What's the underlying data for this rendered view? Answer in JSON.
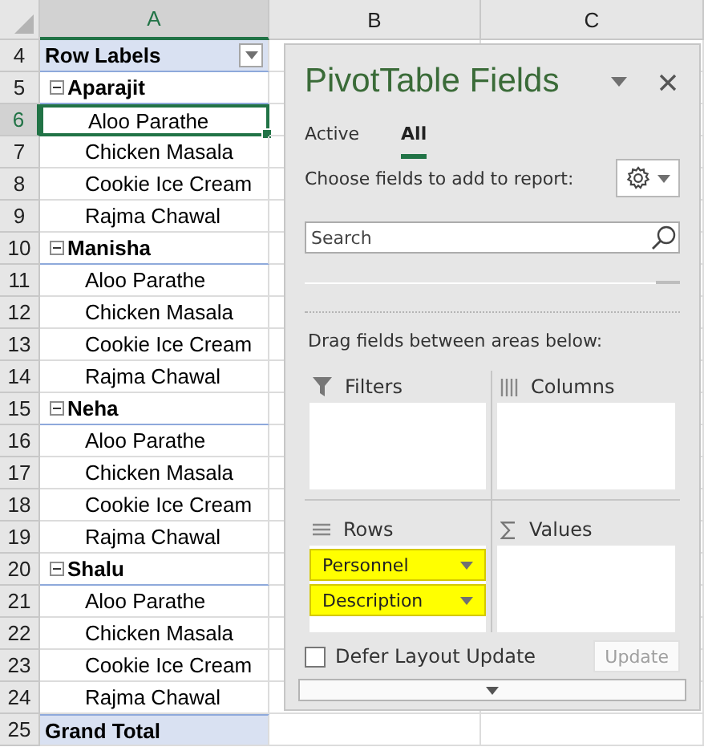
{
  "sheet": {
    "columns": [
      {
        "label": "A",
        "selected": true
      },
      {
        "label": "B",
        "selected": false
      },
      {
        "label": "C",
        "selected": false
      }
    ],
    "rows": [
      {
        "number": "4",
        "kind": "header",
        "label": "Row Labels",
        "selected": false
      },
      {
        "number": "5",
        "kind": "group",
        "label": "Aparajit",
        "expanded": true,
        "selected": false
      },
      {
        "number": "6",
        "kind": "item",
        "label": "Aloo Parathe",
        "selected": true
      },
      {
        "number": "7",
        "kind": "item",
        "label": "Chicken Masala",
        "selected": false
      },
      {
        "number": "8",
        "kind": "item",
        "label": "Cookie Ice Cream",
        "selected": false
      },
      {
        "number": "9",
        "kind": "item",
        "label": "Rajma Chawal",
        "selected": false
      },
      {
        "number": "10",
        "kind": "group",
        "label": "Manisha",
        "expanded": true,
        "selected": false
      },
      {
        "number": "11",
        "kind": "item",
        "label": "Aloo Parathe",
        "selected": false
      },
      {
        "number": "12",
        "kind": "item",
        "label": "Chicken Masala",
        "selected": false
      },
      {
        "number": "13",
        "kind": "item",
        "label": "Cookie Ice Cream",
        "selected": false
      },
      {
        "number": "14",
        "kind": "item",
        "label": "Rajma Chawal",
        "selected": false
      },
      {
        "number": "15",
        "kind": "group",
        "label": "Neha",
        "expanded": true,
        "selected": false
      },
      {
        "number": "16",
        "kind": "item",
        "label": "Aloo Parathe",
        "selected": false
      },
      {
        "number": "17",
        "kind": "item",
        "label": "Chicken Masala",
        "selected": false
      },
      {
        "number": "18",
        "kind": "item",
        "label": "Cookie Ice Cream",
        "selected": false
      },
      {
        "number": "19",
        "kind": "item",
        "label": "Rajma Chawal",
        "selected": false
      },
      {
        "number": "20",
        "kind": "group",
        "label": "Shalu",
        "expanded": true,
        "selected": false
      },
      {
        "number": "21",
        "kind": "item",
        "label": "Aloo Parathe",
        "selected": false
      },
      {
        "number": "22",
        "kind": "item",
        "label": "Chicken Masala",
        "selected": false
      },
      {
        "number": "23",
        "kind": "item",
        "label": "Cookie Ice Cream",
        "selected": false
      },
      {
        "number": "24",
        "kind": "item",
        "label": "Rajma Chawal",
        "selected": false
      },
      {
        "number": "25",
        "kind": "total",
        "label": "Grand Total",
        "selected": false
      }
    ]
  },
  "pivot_pane": {
    "title": "PivotTable Fields",
    "tabs": [
      {
        "label": "Active",
        "selected": false
      },
      {
        "label": "All",
        "selected": true
      }
    ],
    "instruction": "Choose fields to add to report:",
    "search": {
      "placeholder": "Search"
    },
    "areas_hint": "Drag fields between areas below:",
    "areas": [
      {
        "kind": "filters",
        "label": "Filters"
      },
      {
        "kind": "columns",
        "label": "Columns"
      },
      {
        "kind": "rows",
        "label": "Rows",
        "items": [
          {
            "label": "Personnel",
            "highlighted": true
          },
          {
            "label": "Description",
            "highlighted": true
          }
        ]
      },
      {
        "kind": "values",
        "label": "Values"
      }
    ],
    "defer": {
      "label": "Defer Layout Update",
      "checked": false
    },
    "update_button": {
      "label": "Update",
      "disabled": true
    }
  }
}
